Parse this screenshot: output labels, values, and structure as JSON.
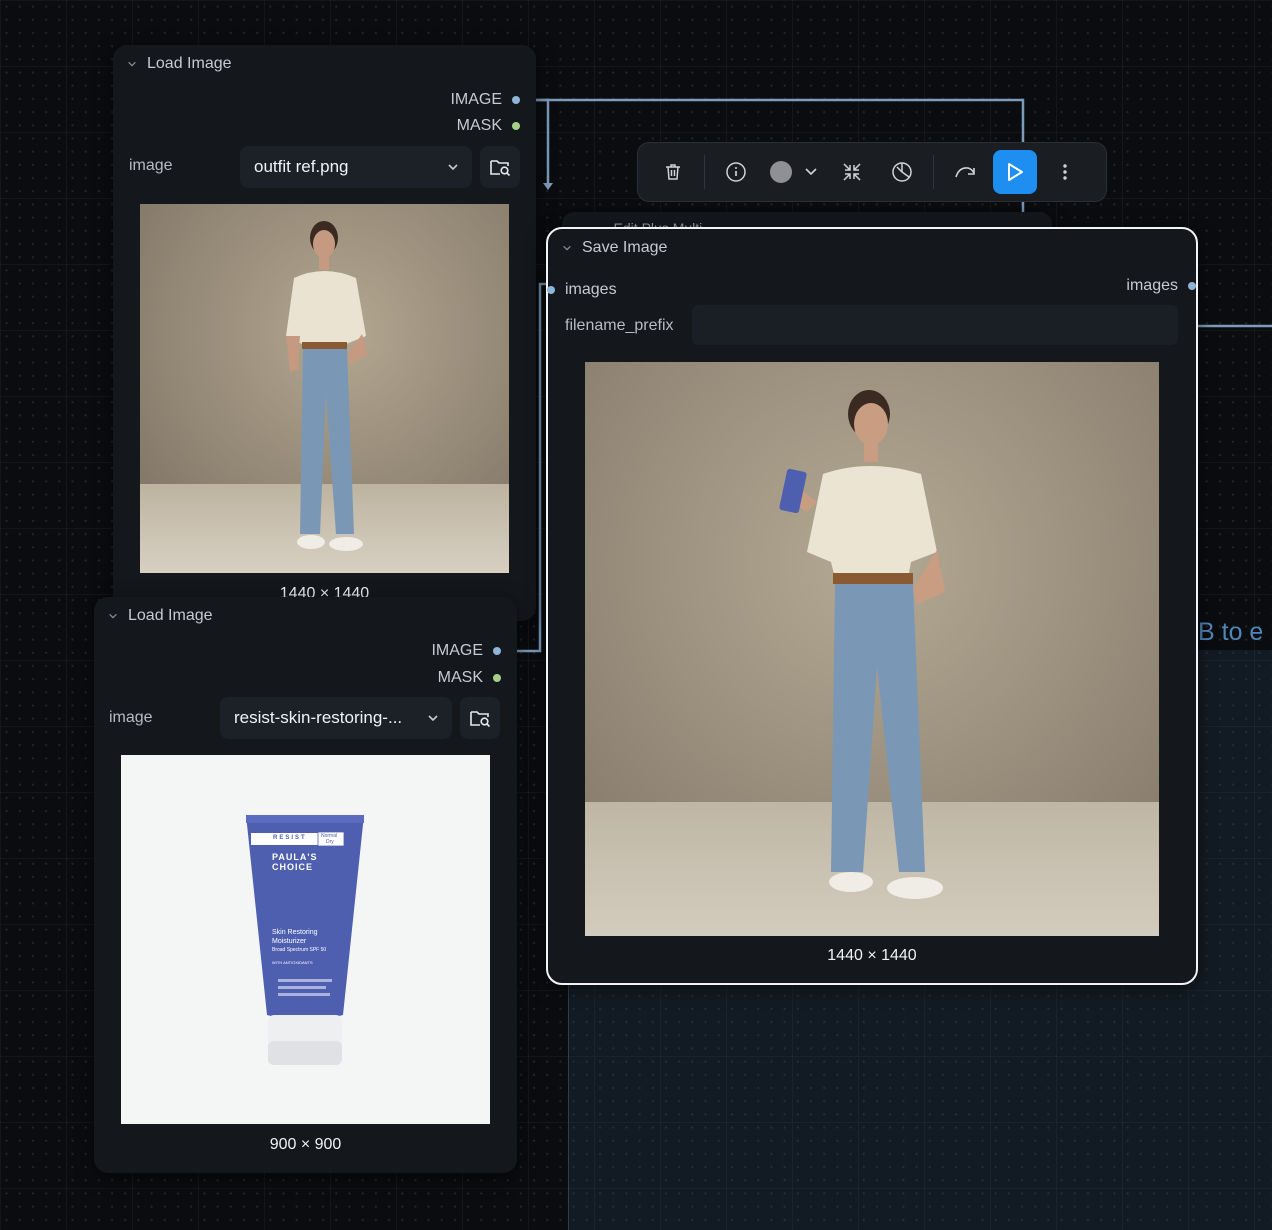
{
  "group": {
    "title_partial": "B to e"
  },
  "hidden_node_title": "... Edit Plus Multi...",
  "load_image_1": {
    "title": "Load Image",
    "outputs": [
      "IMAGE",
      "MASK"
    ],
    "widget_label": "image",
    "value": "outfit ref.png",
    "dims": "1440 × 1440"
  },
  "load_image_2": {
    "title": "Load Image",
    "outputs": [
      "IMAGE",
      "MASK"
    ],
    "widget_label": "image",
    "value": "resist-skin-restoring-...",
    "dims": "900 × 900"
  },
  "save_image": {
    "title": "Save Image",
    "input": "images",
    "output": "images",
    "widget_label": "filename_prefix",
    "prefix_value": "",
    "dims": "1440 × 1440"
  },
  "product": {
    "brand_line1": "PAULA'S",
    "brand_line2": "CHOICE",
    "series": "RESIST",
    "tag_line1": "Normal",
    "tag_line2": "Dry",
    "name_line1": "Skin Restoring",
    "name_line2": "Moisturizer",
    "spf": "Broad Spectrum SPF 50",
    "badge": "WITH ANTIOXIDANTS"
  },
  "toolbar": {
    "icons": [
      "trash-icon",
      "info-icon",
      "color-icon",
      "collapse-icon",
      "bypass-icon",
      "redo-icon",
      "run-icon",
      "more-icon"
    ]
  },
  "colors": {
    "accent": "#1e8ef0",
    "image_link": "#8fb4d8",
    "mask_dot": "#a6d08a",
    "product_blue": "#4f5fb0"
  }
}
